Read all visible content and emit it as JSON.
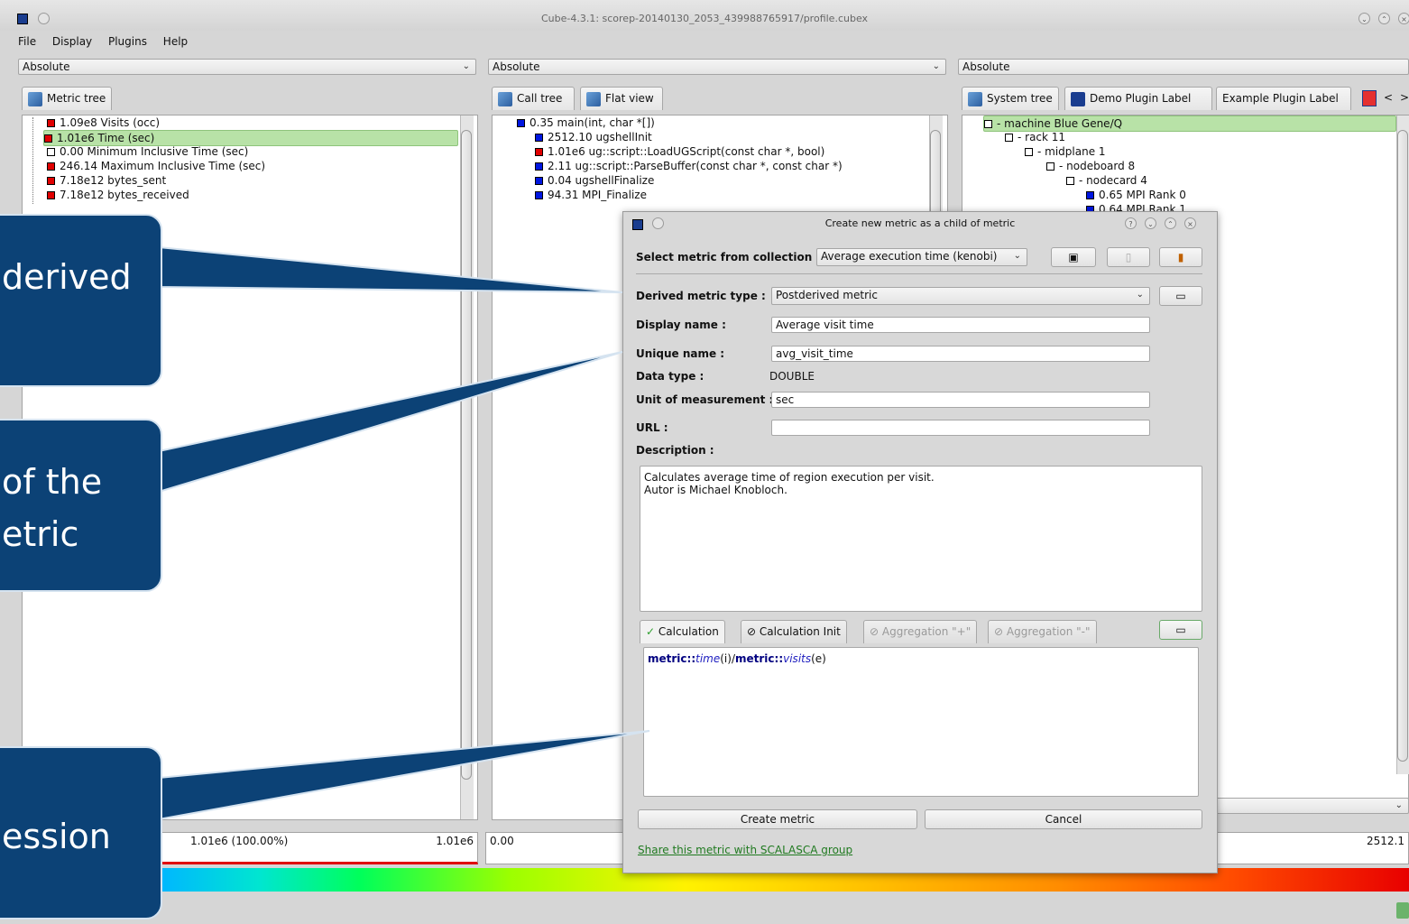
{
  "window": {
    "title": "Cube-4.3.1: scorep-20140130_2053_439988765917/profile.cubex"
  },
  "menu": [
    "File",
    "Display",
    "Plugins",
    "Help"
  ],
  "combos": {
    "left": "Absolute",
    "middle": "Absolute",
    "right": "Absolute"
  },
  "left_panel": {
    "tab": "Metric tree",
    "rows": [
      {
        "label": "1.09e8 Visits (occ)",
        "color": "red"
      },
      {
        "label": "1.01e6 Time (sec)",
        "color": "red",
        "selected": true
      },
      {
        "label": "0.00 Minimum Inclusive Time (sec)",
        "color": "white"
      },
      {
        "label": "246.14 Maximum Inclusive Time (sec)",
        "color": "red"
      },
      {
        "label": "7.18e12 bytes_sent",
        "color": "red"
      },
      {
        "label": "7.18e12 bytes_received",
        "color": "red"
      }
    ],
    "status_left": "1.01e6 (100.00%)",
    "status_right": "1.01e6"
  },
  "middle_panel": {
    "tabs": [
      "Call tree",
      "Flat view"
    ],
    "rows": [
      {
        "label": "0.35 main(int, char *[])",
        "color": "blue"
      },
      {
        "label": "2512.10 ugshellInit",
        "color": "blue"
      },
      {
        "label": "1.01e6 ug::script::LoadUGScript(const char *, bool)",
        "color": "red"
      },
      {
        "label": "2.11 ug::script::ParseBuffer(const char *, const char *)",
        "color": "blue"
      },
      {
        "label": "0.04 ugshellFinalize",
        "color": "blue"
      },
      {
        "label": "94.31 MPI_Finalize",
        "color": "blue"
      }
    ],
    "status_left": "0.00"
  },
  "right_panel": {
    "tabs": [
      "System tree",
      "Demo Plugin Label",
      "Example Plugin Label"
    ],
    "rows": [
      {
        "label": "- machine Blue Gene/Q",
        "color": "white",
        "selected": true
      },
      {
        "label": "- rack 11",
        "color": "white"
      },
      {
        "label": "- midplane 1",
        "color": "white"
      },
      {
        "label": "- nodeboard 8",
        "color": "white"
      },
      {
        "label": "- nodecard 4",
        "color": "white"
      },
      {
        "label": "0.65 MPI Rank 0",
        "color": "blue"
      },
      {
        "label": "0.64 MPI Rank 1",
        "color": "blue"
      }
    ],
    "status_right": "2512.1"
  },
  "dialog": {
    "title": "Create new metric as a child of metric",
    "collection_label": "Select metric from collection :",
    "collection_value": "Average execution time (kenobi)",
    "type_label": "Derived metric type :",
    "type_value": "Postderived metric",
    "display_label": "Display name :",
    "display_value": "Average visit time",
    "unique_label": "Unique name :",
    "unique_value": "avg_visit_time",
    "datatype_label": "Data type :",
    "datatype_value": "DOUBLE",
    "unit_label": "Unit of measurement :",
    "unit_value": "sec",
    "url_label": "URL :",
    "url_value": "",
    "description_label": "Description :",
    "description_line1": "Calculates average time of region execution per visit.",
    "description_line2": "Autor is Michael Knobloch.",
    "tabs": [
      "Calculation",
      "Calculation Init",
      "Aggregation \"+\"",
      "Aggregation \"-\""
    ],
    "expression": {
      "ns1": "metric::",
      "fn1": "time",
      "arg1": "(i)",
      "op": "/",
      "ns2": "metric::",
      "fn2": "visits",
      "arg2": "(e)"
    },
    "create_button": "Create metric",
    "cancel_button": "Cancel",
    "share_link": "Share this metric with SCALASCA group"
  },
  "callouts": {
    "top": "derived",
    "middle_line1": "of the",
    "middle_line2": "etric",
    "bottom": "ession"
  }
}
